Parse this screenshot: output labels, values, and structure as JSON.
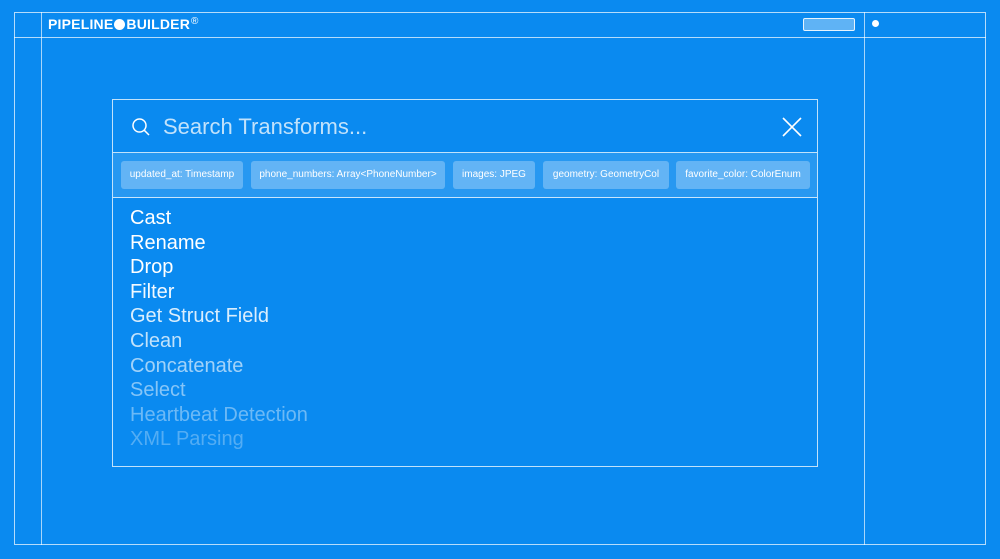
{
  "header": {
    "brand_part1": "PIPELINE",
    "brand_part2": "BUILDER",
    "brand_mark": "®"
  },
  "search": {
    "placeholder": "Search Transforms...",
    "value": ""
  },
  "icons": {
    "search": "search-icon",
    "close": "close-icon"
  },
  "columns": [
    {
      "label": "updated_at: Timestamp"
    },
    {
      "label": "phone_numbers: Array<PhoneNumber>"
    },
    {
      "label": "images: JPEG"
    },
    {
      "label": "geometry: GeometryCol"
    },
    {
      "label": "favorite_color: ColorEnum"
    }
  ],
  "transforms": [
    {
      "label": "Cast",
      "opacity": 1.0
    },
    {
      "label": "Rename",
      "opacity": 1.0
    },
    {
      "label": "Drop",
      "opacity": 1.0
    },
    {
      "label": "Filter",
      "opacity": 0.95
    },
    {
      "label": "Get Struct Field",
      "opacity": 0.85
    },
    {
      "label": "Clean",
      "opacity": 0.75
    },
    {
      "label": "Concatenate",
      "opacity": 0.62
    },
    {
      "label": "Select",
      "opacity": 0.5
    },
    {
      "label": "Heartbeat Detection",
      "opacity": 0.4
    },
    {
      "label": "XML Parsing",
      "opacity": 0.3
    }
  ],
  "colors": {
    "background": "#0a8af0",
    "foreground": "#ffffff"
  }
}
